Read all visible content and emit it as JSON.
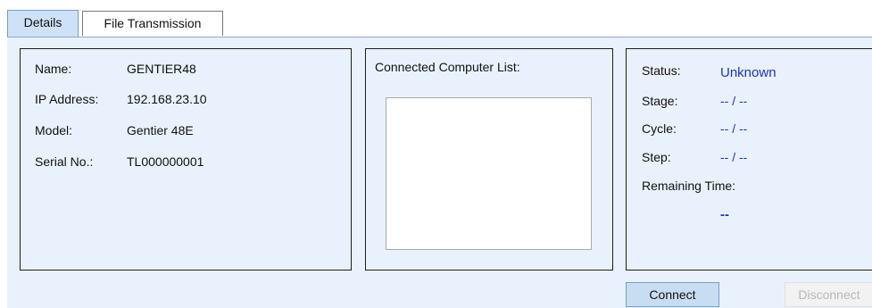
{
  "tabs": [
    {
      "label": "Details",
      "active": true
    },
    {
      "label": "File Transmission",
      "active": false
    }
  ],
  "device_info": {
    "name_label": "Name:",
    "name_value": "GENTIER48",
    "ip_label": "IP Address:",
    "ip_value": "192.168.23.10",
    "model_label": "Model:",
    "model_value": "Gentier 48E",
    "serial_label": "Serial No.:",
    "serial_value": "TL000000001"
  },
  "connected_computers": {
    "title": "Connected Computer List:",
    "items": []
  },
  "run_status": {
    "status_label": "Status:",
    "status_value": "Unknown",
    "stage_label": "Stage:",
    "stage_value": "-- / --",
    "cycle_label": "Cycle:",
    "cycle_value": "-- / --",
    "step_label": "Step:",
    "step_value": "-- / --",
    "remaining_label": "Remaining Time:",
    "remaining_value": "--"
  },
  "buttons": {
    "connect": "Connect",
    "disconnect": "Disconnect"
  },
  "colors": {
    "panel_background": "#e9f2fc",
    "status_value": "#1a32d0",
    "active_tab": "#cfe1f7"
  }
}
